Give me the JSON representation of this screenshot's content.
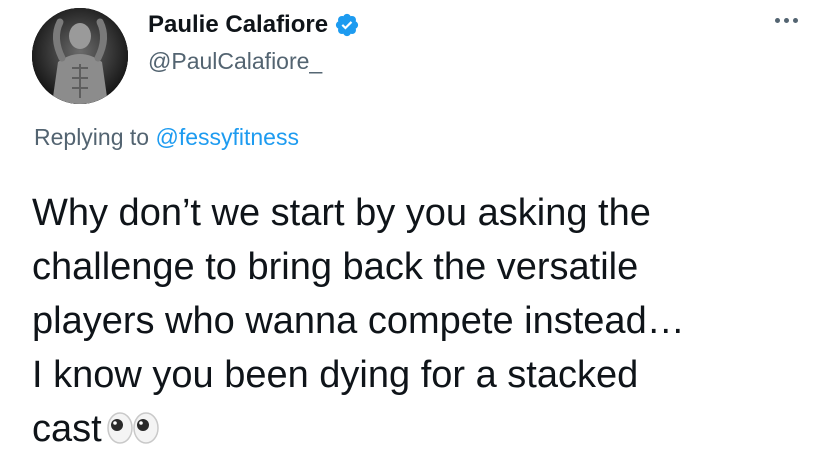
{
  "author": {
    "display_name": "Paulie Calafiore",
    "handle": "@PaulCalafiore_",
    "verified": true,
    "avatar_icon": "profile-photo"
  },
  "reply": {
    "prefix": "Replying to",
    "mention": "@fessyfitness"
  },
  "tweet": {
    "text": "Why don’t we start by you asking the\nchallenge to bring back the versatile\nplayers who wanna compete instead…\nI know you been dying for a stacked\ncast",
    "emoji": "eyes-emoji"
  },
  "icons": {
    "verified": "verified-badge-icon",
    "more": "more-options-icon"
  },
  "colors": {
    "text_primary": "#0f1419",
    "text_secondary": "#536471",
    "link": "#1d9bf0",
    "verified": "#1d9bf0"
  }
}
